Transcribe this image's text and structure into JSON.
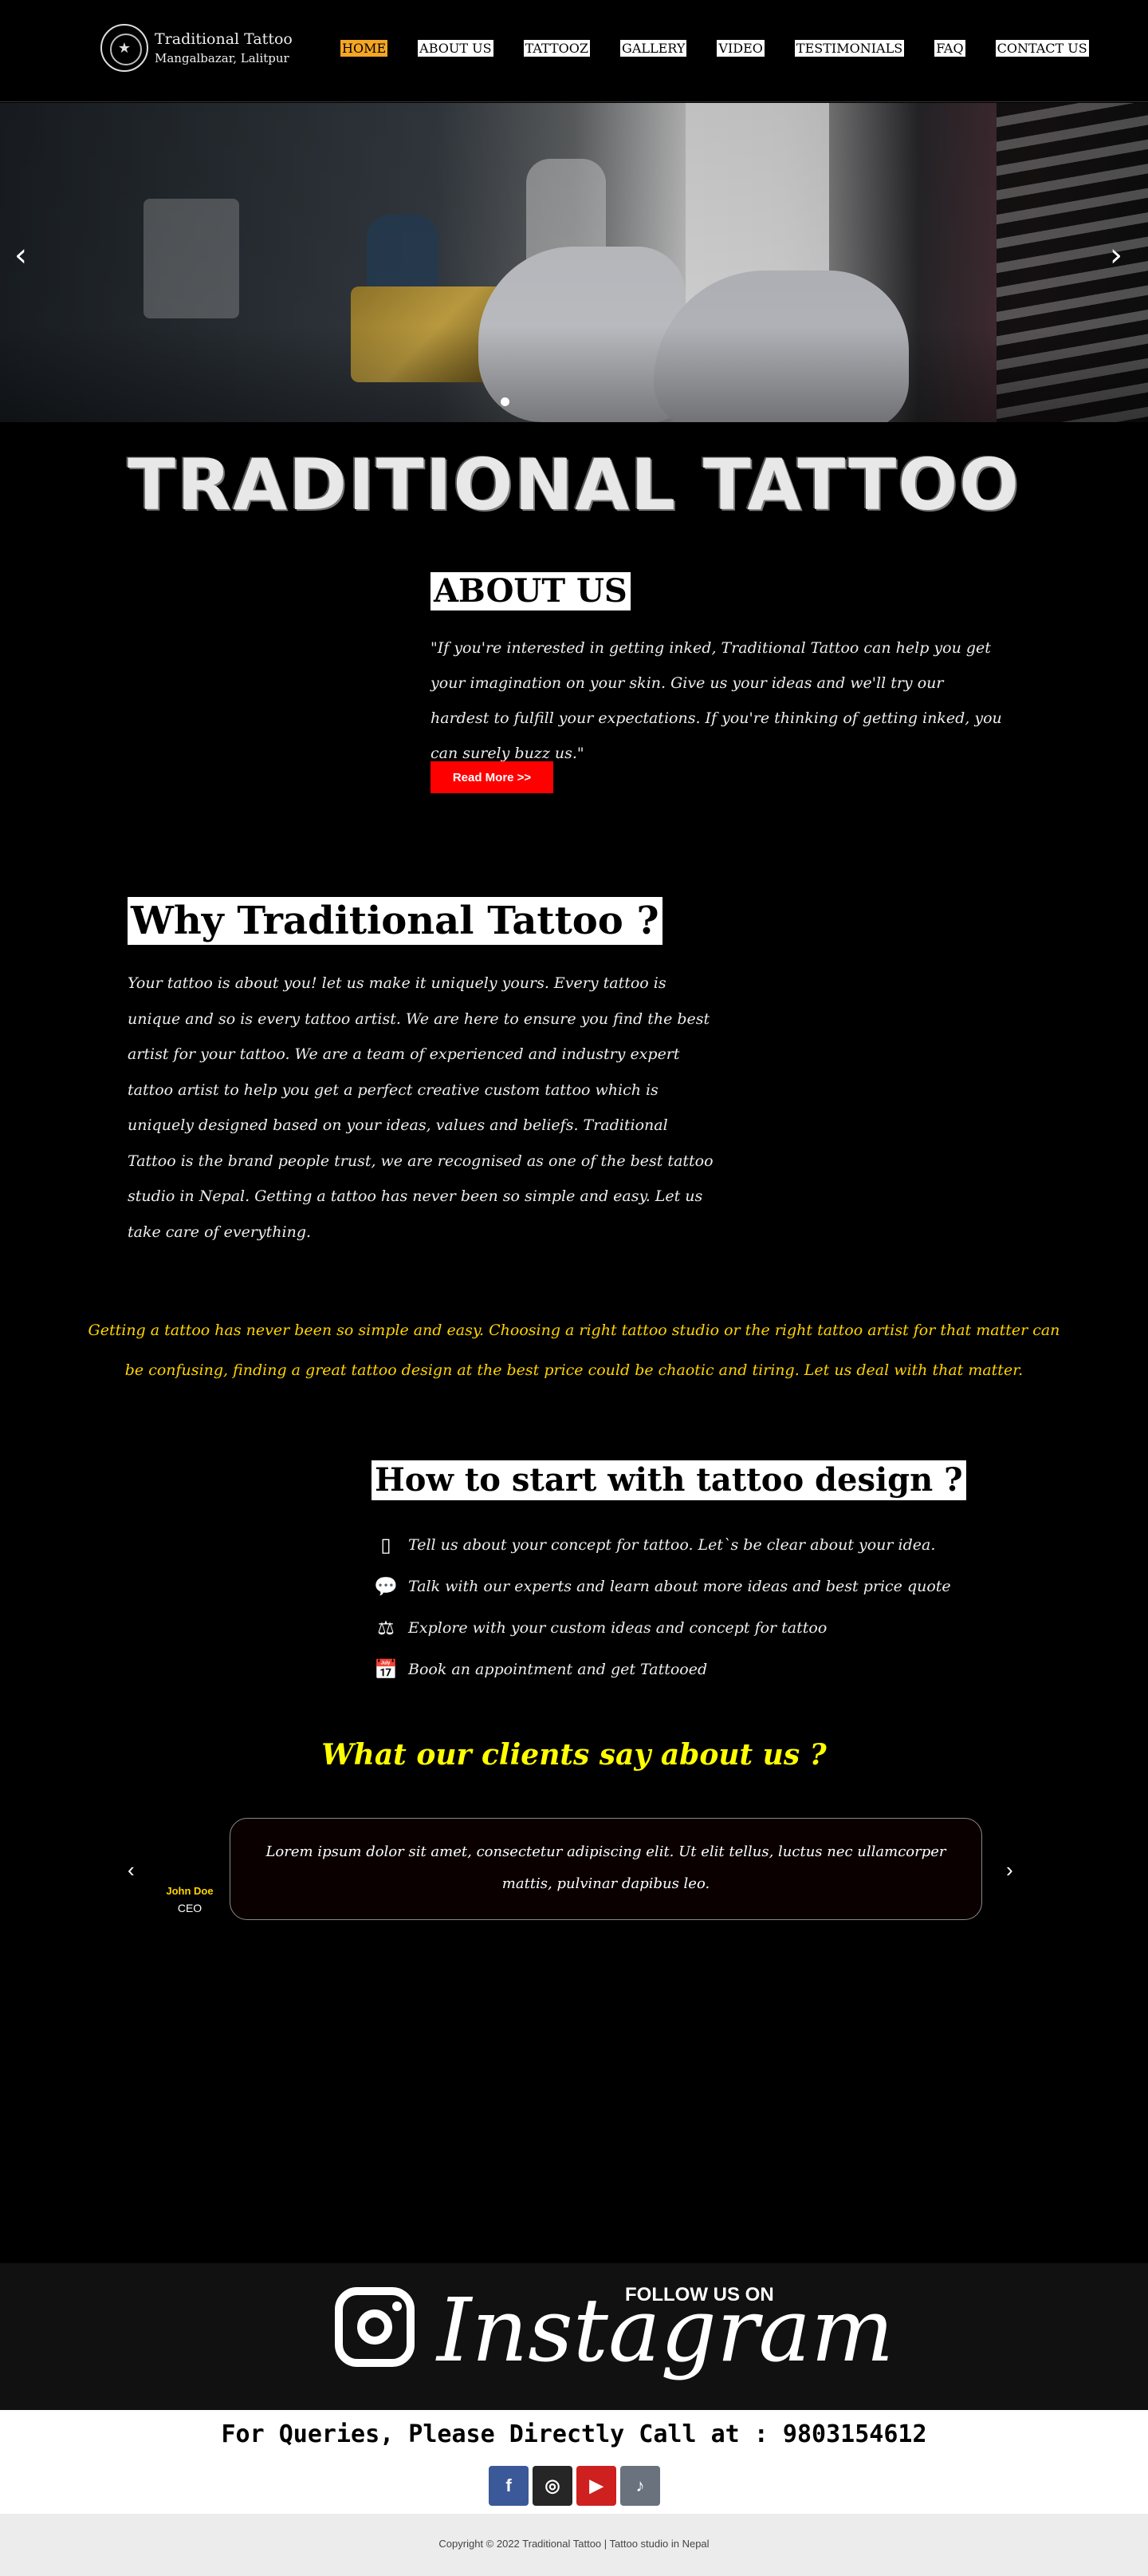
{
  "header": {
    "logo_line1": "Traditional Tattoo",
    "logo_line2": "Mangalbazar, Lalitpur",
    "nav": [
      "HOME",
      "ABOUT US",
      "TATTOOZ",
      "GALLERY",
      "VIDEO",
      "TESTIMONIALS",
      "FAQ",
      "CONTACT US"
    ],
    "active_nav": "HOME"
  },
  "hero": {
    "prev_arrow": "‹",
    "next_arrow": "›"
  },
  "brand_title": "TRADITIONAL TATTOO",
  "about": {
    "heading": "ABOUT US",
    "text": "\"If you're interested in getting inked, Traditional Tattoo can help you get your imagination on your skin. Give us your ideas and we'll try our hardest to fulfill your expectations. If you're thinking of getting inked, you can surely buzz us.\"",
    "button": "Read More >>"
  },
  "why": {
    "heading": "Why Traditional Tattoo ?",
    "text": "Your tattoo is about you! let us make it uniquely yours. Every tattoo is unique and so is every tattoo artist. We are here to ensure you find the best artist for your tattoo. We are a team of experienced and industry expert tattoo artist to help you get a perfect creative custom tattoo which is uniquely designed based on your ideas, values and beliefs. Traditional Tattoo is the brand people trust, we are recognised as one of the best tattoo studio in Nepal. Getting a tattoo has never been so simple and easy. Let us take care of everything."
  },
  "yellow_quote": "Getting a tattoo has never been so simple and easy. Choosing a right tattoo studio or the right tattoo artist for that matter can be confusing, finding a great tattoo design at the best price could be chaotic and tiring. Let us deal with that matter.",
  "how": {
    "heading": "How to start with tattoo design ?",
    "steps": [
      {
        "icon": "mobile-phone-icon",
        "glyph": "▯",
        "text": "Tell us about your concept for tattoo. Let`s be clear about your idea."
      },
      {
        "icon": "chat-bubble-icon",
        "glyph": "💬",
        "text": "Talk with our experts and learn about more ideas and best price quote"
      },
      {
        "icon": "balance-scale-icon",
        "glyph": "⚖",
        "text": "Explore with your custom ideas and concept for tattoo"
      },
      {
        "icon": "calendar-check-icon",
        "glyph": "📅",
        "text": "Book an appointment and get Tattooed"
      }
    ]
  },
  "testimonials": {
    "heading": "What our clients say about us ?",
    "prev": "‹",
    "next": "›",
    "author_name": "John Doe",
    "author_role": "CEO",
    "quote": "Lorem ipsum dolor sit amet, consectetur adipiscing elit. Ut elit tellus, luctus nec ullamcorper mattis, pulvinar dapibus leo."
  },
  "instagram": {
    "follow": "FOLLOW US ON",
    "word": "Instagram"
  },
  "queries": {
    "text": "For Queries, Please Directly Call at : 9803154612",
    "socials": [
      {
        "name": "facebook-icon",
        "glyph": "f",
        "color": "#3b5998"
      },
      {
        "name": "instagram-icon",
        "glyph": "◎",
        "color": "#262626"
      },
      {
        "name": "youtube-icon",
        "glyph": "▶",
        "color": "#cd201f"
      },
      {
        "name": "tiktok-icon",
        "glyph": "♪",
        "color": "#69727d"
      }
    ]
  },
  "footer": {
    "copyright": "Copyright © 2022 Traditional Tattoo | Tattoo studio in Nepal"
  },
  "colors": {
    "accent_orange": "#f5a623",
    "button_red": "#ff0000",
    "quote_yellow": "#ffd400",
    "testimonial_heading": "#ffff00"
  }
}
